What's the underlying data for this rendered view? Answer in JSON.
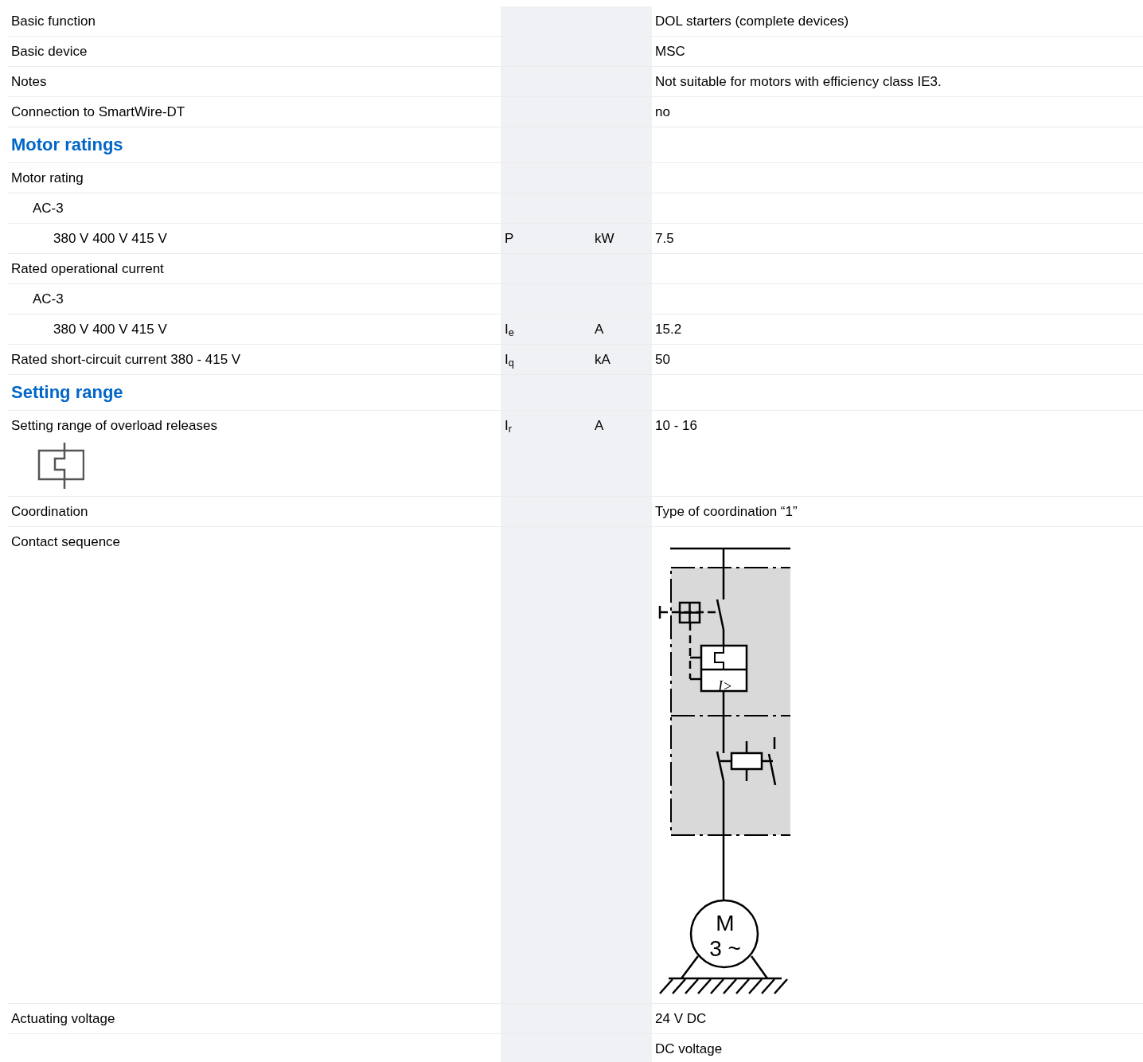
{
  "rows": [
    {
      "kind": "row",
      "label": "Basic function",
      "value": "DOL starters (complete devices)"
    },
    {
      "kind": "row",
      "label": "Basic device",
      "value": "MSC"
    },
    {
      "kind": "row",
      "label": "Notes",
      "value": "Not suitable for motors with efficiency class IE3."
    },
    {
      "kind": "row",
      "label": "Connection to SmartWire-DT",
      "value": "no"
    },
    {
      "kind": "section",
      "label": "Motor ratings",
      "children": [
        {
          "kind": "row",
          "label": "Motor rating",
          "children": [
            {
              "kind": "row",
              "label": "AC-3",
              "children": [
                {
                  "kind": "row",
                  "label": "380 V 400 V 415 V",
                  "symbol": "P",
                  "unit": "kW",
                  "value": "7.5"
                }
              ]
            }
          ]
        },
        {
          "kind": "row",
          "label": "Rated operational current",
          "children": [
            {
              "kind": "row",
              "label": "AC-3",
              "children": [
                {
                  "kind": "row",
                  "label": "380 V 400 V 415 V",
                  "symbol": "I$_{e}$",
                  "unit": "A",
                  "value": "15.2"
                }
              ]
            }
          ]
        },
        {
          "kind": "row",
          "label": "Rated short-circuit current 380 - 415 V",
          "symbol": "I$_{q}$",
          "unit": "kA",
          "value": "50"
        }
      ]
    },
    {
      "kind": "section",
      "label": "Setting range",
      "children": [
        {
          "kind": "row",
          "label": "Setting range of overload releases",
          "symbol": "I$_{r}$",
          "unit": "A",
          "value": "10 - 16",
          "icon": true
        }
      ]
    },
    {
      "kind": "row",
      "label": "Coordination",
      "value": "Type of coordination “1”"
    },
    {
      "kind": "diagram",
      "label": "Contact sequence",
      "motor_label": "M",
      "motor_phase": "3 ~",
      "release_label": "I>"
    },
    {
      "kind": "row",
      "label": "Actuating voltage",
      "value": "24 V DC"
    },
    {
      "kind": "row",
      "value": "DC voltage"
    }
  ]
}
